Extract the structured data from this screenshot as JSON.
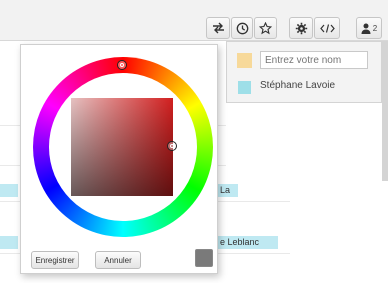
{
  "toolbar": {
    "buttons": [
      {
        "icon": "swap-arrows-icon"
      },
      {
        "icon": "clock-icon"
      },
      {
        "icon": "star-icon"
      },
      {
        "icon": "gear-icon"
      },
      {
        "icon": "code-icon"
      },
      {
        "icon": "user-icon",
        "badge": "2"
      }
    ]
  },
  "users_panel": {
    "name_input": {
      "placeholder": "Entrez votre nom",
      "value": ""
    },
    "own_color": "#f7d99a",
    "users": [
      {
        "name": "Stéphane Lavoie",
        "color": "#9edfe8"
      }
    ]
  },
  "document": {
    "fragments": [
      {
        "text": "La"
      },
      {
        "text": "e Leblanc"
      }
    ],
    "highlight_color": "#bfe9f2"
  },
  "color_picker": {
    "save_label": "Enregistrer",
    "cancel_label": "Annuler",
    "selected_color": "#7a7a7a"
  }
}
